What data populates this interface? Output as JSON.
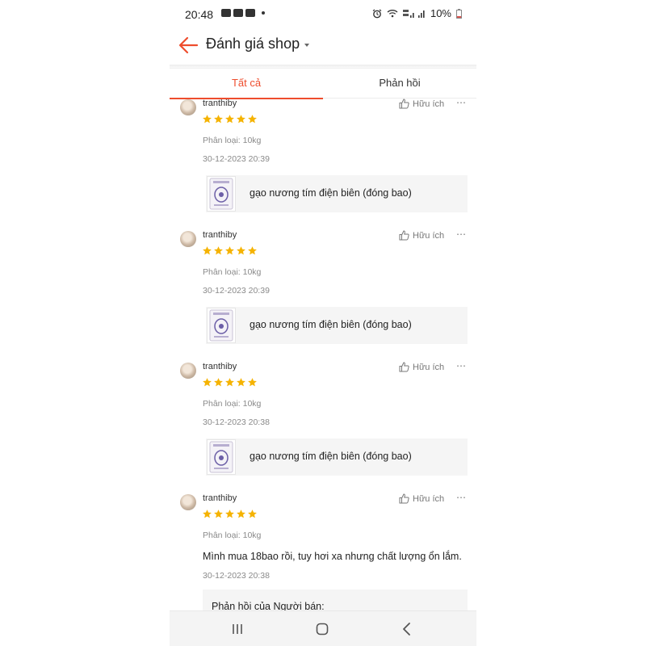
{
  "status": {
    "time": "20:48",
    "battery": "10%"
  },
  "header": {
    "title": "Đánh giá shop",
    "back_icon": "arrow-left-icon",
    "accent_color": "#ee4d2d"
  },
  "tabs": [
    {
      "label": "Tất cả",
      "active": true
    },
    {
      "label": "Phản hồi",
      "active": false
    }
  ],
  "reviews": [
    {
      "username": "tranthiby",
      "helpful_label": "Hữu ích",
      "rating": 5,
      "variant": "Phân loại: 10kg",
      "date": "30-12-2023 20:39",
      "product_name": "gạo nương tím điện biên (đóng bao)"
    },
    {
      "username": "tranthiby",
      "helpful_label": "Hữu ích",
      "rating": 5,
      "variant": "Phân loại: 10kg",
      "date": "30-12-2023 20:39",
      "product_name": "gạo nương tím điện biên (đóng bao)"
    },
    {
      "username": "tranthiby",
      "helpful_label": "Hữu ích",
      "rating": 5,
      "variant": "Phân loại: 10kg",
      "date": "30-12-2023 20:38",
      "product_name": "gạo nương tím điện biên (đóng bao)"
    },
    {
      "username": "tranthiby",
      "helpful_label": "Hữu ích",
      "rating": 5,
      "variant": "Phân loại: 10kg",
      "text": "Mình mua 18bao rồi, tuy hơi xa nhưng chất lượng ổn lắm.",
      "date": "30-12-2023 20:38",
      "seller_reply_label": "Phản hồi của Người bán:"
    }
  ],
  "star_color": "#f5b301"
}
